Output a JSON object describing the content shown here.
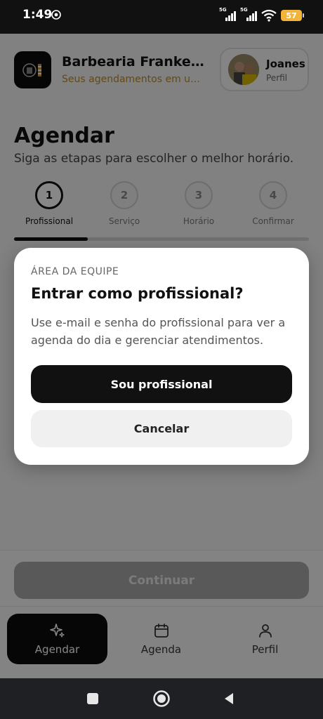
{
  "status_bar": {
    "time": "1:49",
    "network_1": "5G",
    "network_2": "5G",
    "battery": "57"
  },
  "header": {
    "title": "Barbearia Frankenstein",
    "subtitle": "Seus agendamentos em um só lugar",
    "profile_name": "Joanes",
    "profile_sub": "Perfil"
  },
  "page": {
    "title": "Agendar",
    "subtitle": "Siga as etapas para escolher o melhor horário."
  },
  "steps": [
    {
      "num": "1",
      "label": "Profissional",
      "active": true
    },
    {
      "num": "2",
      "label": "Serviço",
      "active": false
    },
    {
      "num": "3",
      "label": "Horário",
      "active": false
    },
    {
      "num": "4",
      "label": "Confirmar",
      "active": false
    }
  ],
  "progress_fraction": 0.25,
  "modal": {
    "eyebrow": "ÁREA DA EQUIPE",
    "title": "Entrar como profissional?",
    "body": "Use e-mail e senha do profissional para ver a agenda do dia e gerenciar atendimentos.",
    "primary": "Sou profissional",
    "secondary": "Cancelar"
  },
  "continue_label": "Continuar",
  "tabs": [
    {
      "label": "Agendar",
      "icon": "sparkle-icon",
      "active": true
    },
    {
      "label": "Agenda",
      "icon": "calendar-icon",
      "active": false
    },
    {
      "label": "Perfil",
      "icon": "user-icon",
      "active": false
    }
  ]
}
